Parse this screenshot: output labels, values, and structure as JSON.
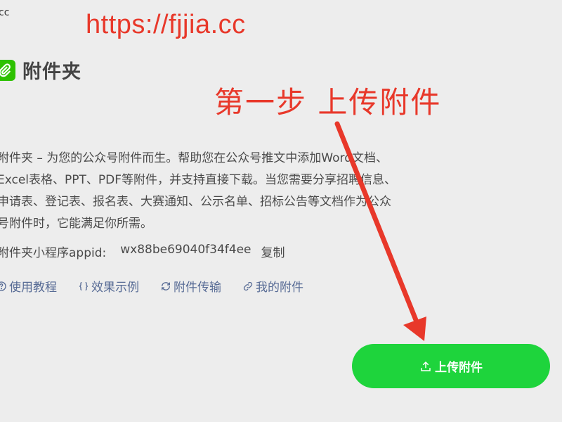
{
  "corner_text": "cc",
  "watermark_url": "https://fjjia.cc",
  "app": {
    "title": "附件夹",
    "logo_icon": "paperclip-icon",
    "accent_color": "#2dc100"
  },
  "annotation": {
    "step_text": "第一步  上传附件",
    "color": "#e8382a"
  },
  "description_lines": [
    "附件夹 – 为您的公众号附件而生。帮助您在公众号推文中添加Word文档、",
    "Excel表格、PPT、PDF等附件，并支持直接下载。当您需要分享招聘信息、",
    "申请表、登记表、报名表、大赛通知、公示名单、招标公告等文档作为公众",
    "号附件时，它能满足你所需。"
  ],
  "appid": {
    "label": "附件夹小程序appid:",
    "value": "wx88be69040f34f4ee",
    "copy_label": "复制"
  },
  "links": [
    {
      "icon": "help-circle-icon",
      "label": "使用教程"
    },
    {
      "icon": "braces-icon",
      "label": "效果示例"
    },
    {
      "icon": "sync-icon",
      "label": "附件传输"
    },
    {
      "icon": "link-icon",
      "label": "我的附件"
    }
  ],
  "upload_button": {
    "icon": "upload-icon",
    "label": "上传附件",
    "color": "#1ed43c"
  }
}
